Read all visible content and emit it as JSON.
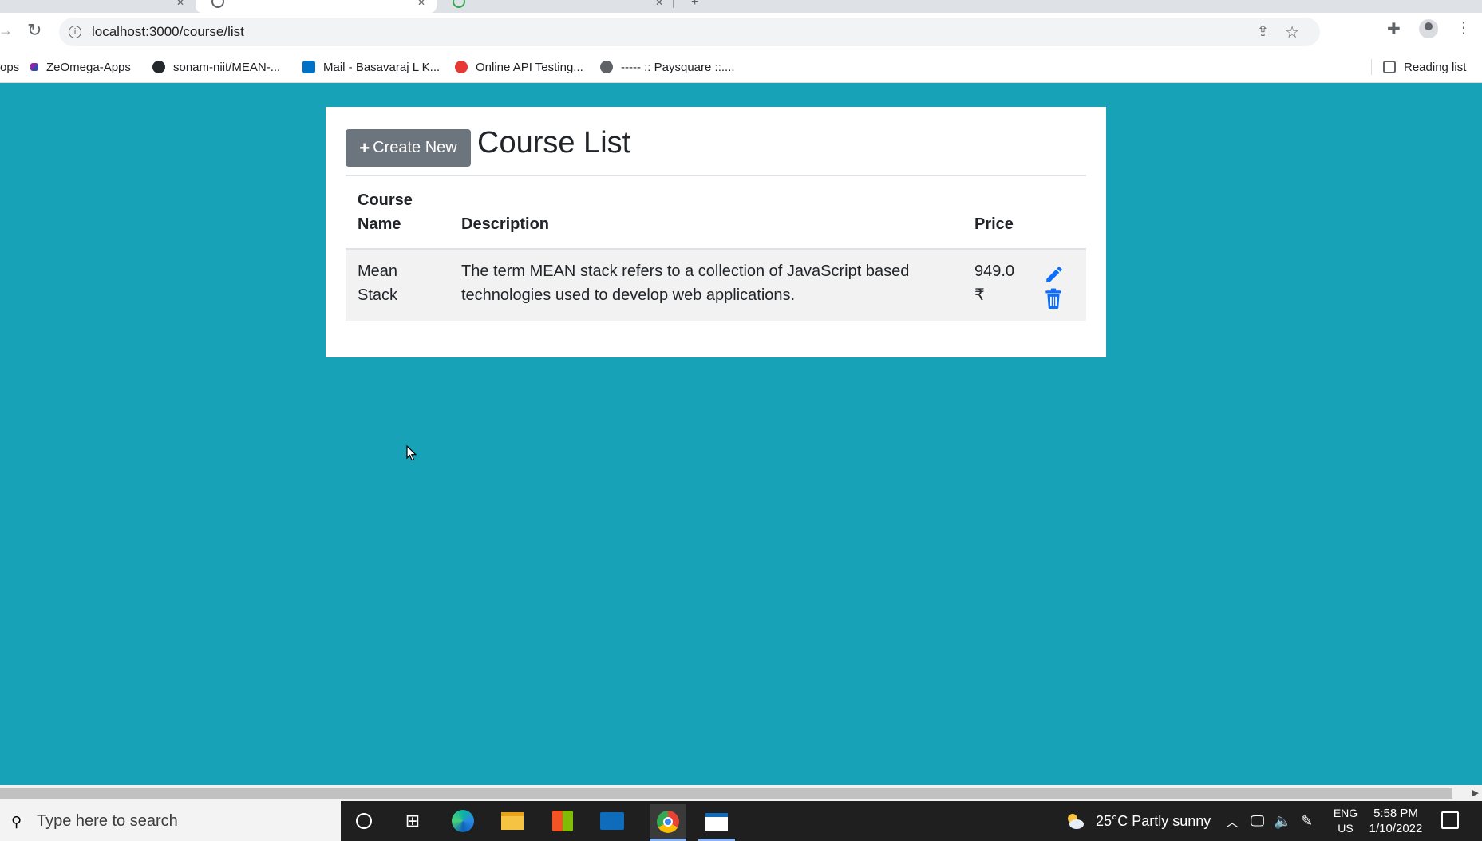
{
  "browser": {
    "url": "localhost:3000/course/list",
    "bookmarks": [
      {
        "label": "ops"
      },
      {
        "label": "ZeOmega-Apps"
      },
      {
        "label": "sonam-niit/MEAN-..."
      },
      {
        "label": "Mail - Basavaraj L K..."
      },
      {
        "label": "Online API Testing..."
      },
      {
        "label": "----- :: Paysquare ::...."
      }
    ],
    "reading_list": "Reading list"
  },
  "page": {
    "create_button_label": "Create New",
    "title": "Course List",
    "table": {
      "headers": {
        "course_name": "Course Name",
        "description": "Description",
        "price": "Price"
      },
      "rows": [
        {
          "course_name": "Mean Stack",
          "description": "The term MEAN stack refers to a collection of JavaScript based technologies used to develop web applications.",
          "price": "949.0 ₹"
        }
      ]
    }
  },
  "taskbar": {
    "search_placeholder": "Type here to search",
    "weather": "25°C  Partly sunny",
    "lang_line1": "ENG",
    "lang_line2": "US",
    "time": "5:58 PM",
    "date": "1/10/2022"
  },
  "colors": {
    "page_background": "#17a2b8",
    "create_button": "#6c757d",
    "action_icons": "#0d6efd"
  }
}
